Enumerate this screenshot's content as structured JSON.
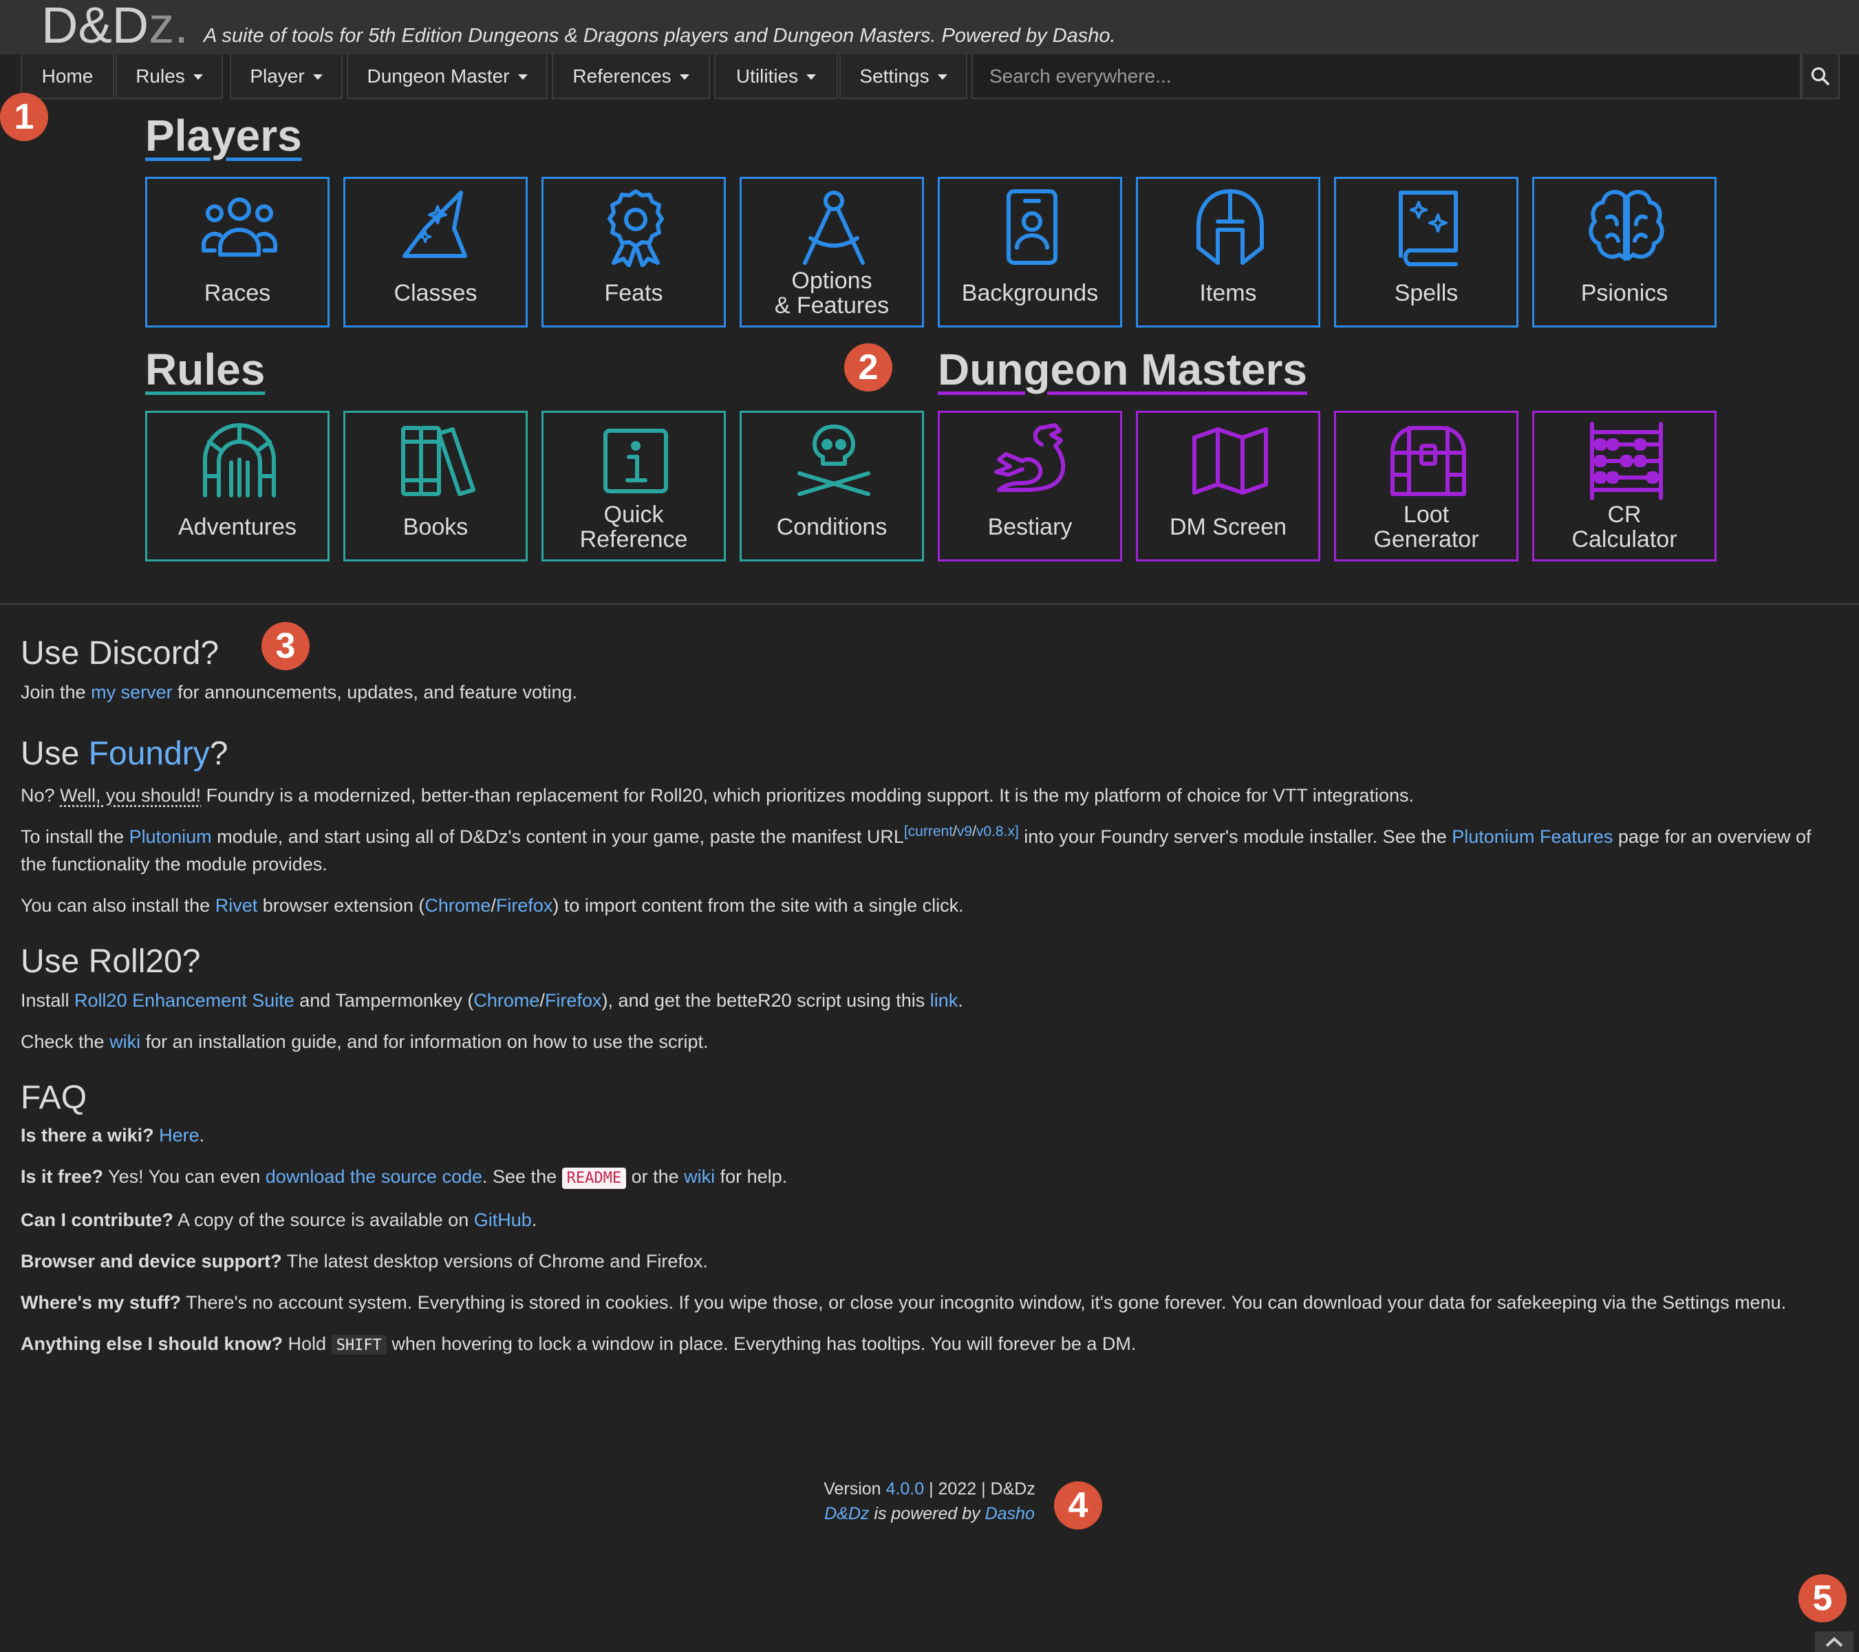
{
  "header": {
    "brand_main": "D&D",
    "brand_z": "z.",
    "tagline": "A suite of tools for 5th Edition Dungeons & Dragons players and Dungeon Masters. Powered by Dasho."
  },
  "nav": {
    "home": "Home",
    "rules": "Rules",
    "player": "Player",
    "dungeon_master": "Dungeon Master",
    "references": "References",
    "utilities": "Utilities",
    "settings": "Settings",
    "search_placeholder": "Search everywhere..."
  },
  "markers": [
    "1",
    "2",
    "3",
    "4",
    "5"
  ],
  "sections": {
    "players": "Players",
    "rules": "Rules",
    "dungeon_masters": "Dungeon Masters"
  },
  "tiles": {
    "players": [
      {
        "label": "Races",
        "icon": "users-icon"
      },
      {
        "label": "Classes",
        "icon": "wizard-hat-icon"
      },
      {
        "label": "Feats",
        "icon": "award-ribbon-icon"
      },
      {
        "label": "Options\n& Features",
        "icon": "compass-drafting-icon"
      },
      {
        "label": "Backgrounds",
        "icon": "id-badge-icon"
      },
      {
        "label": "Items",
        "icon": "helmet-icon"
      },
      {
        "label": "Spells",
        "icon": "spellbook-icon"
      },
      {
        "label": "Psionics",
        "icon": "brain-icon"
      }
    ],
    "rules": [
      {
        "label": "Adventures",
        "icon": "dungeon-gate-icon"
      },
      {
        "label": "Books",
        "icon": "books-icon"
      },
      {
        "label": "Quick\nReference",
        "icon": "info-icon"
      },
      {
        "label": "Conditions",
        "icon": "skull-crossbones-icon"
      }
    ],
    "dungeon_masters": [
      {
        "label": "Bestiary",
        "icon": "dragon-icon"
      },
      {
        "label": "DM Screen",
        "icon": "map-icon"
      },
      {
        "label": "Loot\nGenerator",
        "icon": "treasure-chest-icon"
      },
      {
        "label": "CR\nCalculator",
        "icon": "abacus-icon"
      }
    ]
  },
  "discord": {
    "heading": "Use Discord?",
    "text_before": "Join the ",
    "link": "my server",
    "text_after": " for announcements, updates, and feature voting."
  },
  "foundry": {
    "heading_before": "Use ",
    "heading_link": "Foundry",
    "heading_after": "?",
    "p1_before": "No? ",
    "p1_dotted": "Well, you should!",
    "p1_after": " Foundry is a modernized, better-than replacement for Roll20, which prioritizes modding support. It is the my platform of choice for VTT integrations.",
    "p2_a": "To install the ",
    "p2_plutonium": "Plutonium",
    "p2_b": " module, and start using all of D&Dz's content in your game, paste the manifest URL",
    "p2_sup_current": "[current",
    "p2_sup_slash1": "/",
    "p2_sup_v9": "v9",
    "p2_sup_slash2": "/",
    "p2_sup_v08": "v0.8.x]",
    "p2_c": " into your Foundry server's module installer. See the ",
    "p2_features": "Plutonium Features",
    "p2_d": " page for an overview of the functionality the module provides.",
    "p3_a": "You can also install the ",
    "p3_rivet": "Rivet",
    "p3_b": " browser extension (",
    "p3_chrome": "Chrome",
    "p3_slash": "/",
    "p3_firefox": "Firefox",
    "p3_c": ") to import content from the site with a single click."
  },
  "roll20": {
    "heading": "Use Roll20?",
    "p1_a": "Install ",
    "p1_res": "Roll20 Enhancement Suite",
    "p1_b": " and Tampermonkey (",
    "p1_chrome": "Chrome",
    "p1_slash": "/",
    "p1_firefox": "Firefox",
    "p1_c": "), and get the betteR20 script using this ",
    "p1_link": "link",
    "p1_d": ".",
    "p2_a": "Check the ",
    "p2_wiki": "wiki",
    "p2_b": " for an installation guide, and for information on how to use the script."
  },
  "faq": {
    "heading": "FAQ",
    "q1": "Is there a wiki?",
    "a1_link": "Here",
    "a1_end": ".",
    "q2": "Is it free?",
    "a2_a": " Yes! You can even ",
    "a2_link": "download the source code",
    "a2_b": ". See the ",
    "a2_code": "README",
    "a2_c": " or the ",
    "a2_wiki": "wiki",
    "a2_d": " for help.",
    "q3": "Can I contribute?",
    "a3_a": " A copy of the source is available on ",
    "a3_link": "GitHub",
    "a3_b": ".",
    "q4": "Browser and device support?",
    "a4": " The latest desktop versions of Chrome and Firefox.",
    "q5": "Where's my stuff?",
    "a5": " There's no account system. Everything is stored in cookies. If you wipe those, or close your incognito window, it's gone forever. You can download your data for safekeeping via the Settings menu.",
    "q6": "Anything else I should know?",
    "a6_a": " Hold ",
    "a6_kbd": "SHIFT",
    "a6_b": " when hovering to lock a window in place. Everything has tooltips. You will forever be a DM."
  },
  "footer": {
    "version_label": "Version ",
    "version": "4.0.0",
    "rest": " | 2022 | D&Dz",
    "brand": "D&Dz",
    "powered": " is powered by ",
    "dasho": "Dasho"
  },
  "colors": {
    "players_accent": "#2a8be9",
    "rules_accent": "#2aa6a0",
    "dm_accent": "#a123d8",
    "marker": "#d9543a",
    "link": "#67aef7"
  }
}
